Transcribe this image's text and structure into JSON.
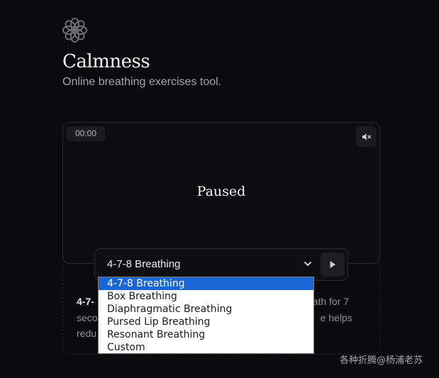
{
  "header": {
    "logo_icon": "flower-icon",
    "title": "Calmness",
    "subtitle": "Online breathing exercises tool."
  },
  "player": {
    "timer": "00:00",
    "mute_icon": "volume-mute-icon",
    "status": "Paused"
  },
  "controls": {
    "selected": "4-7-8 Breathing",
    "play_icon": "play-icon",
    "options": [
      "4-7-8 Breathing",
      "Box Breathing",
      "Diaphragmatic Breathing",
      "Pursed Lip Breathing",
      "Resonant Breathing",
      "Custom"
    ]
  },
  "description": {
    "visible_start_bold": "4-7-",
    "line1_end": "eath for 7",
    "line2_start": "seco",
    "line2_end": "e helps",
    "line3_start": "redu"
  },
  "watermark": "各种折腾@杨浦老苏",
  "colors": {
    "background": "#0b0b0d",
    "accent_selected": "#1a66d6"
  }
}
